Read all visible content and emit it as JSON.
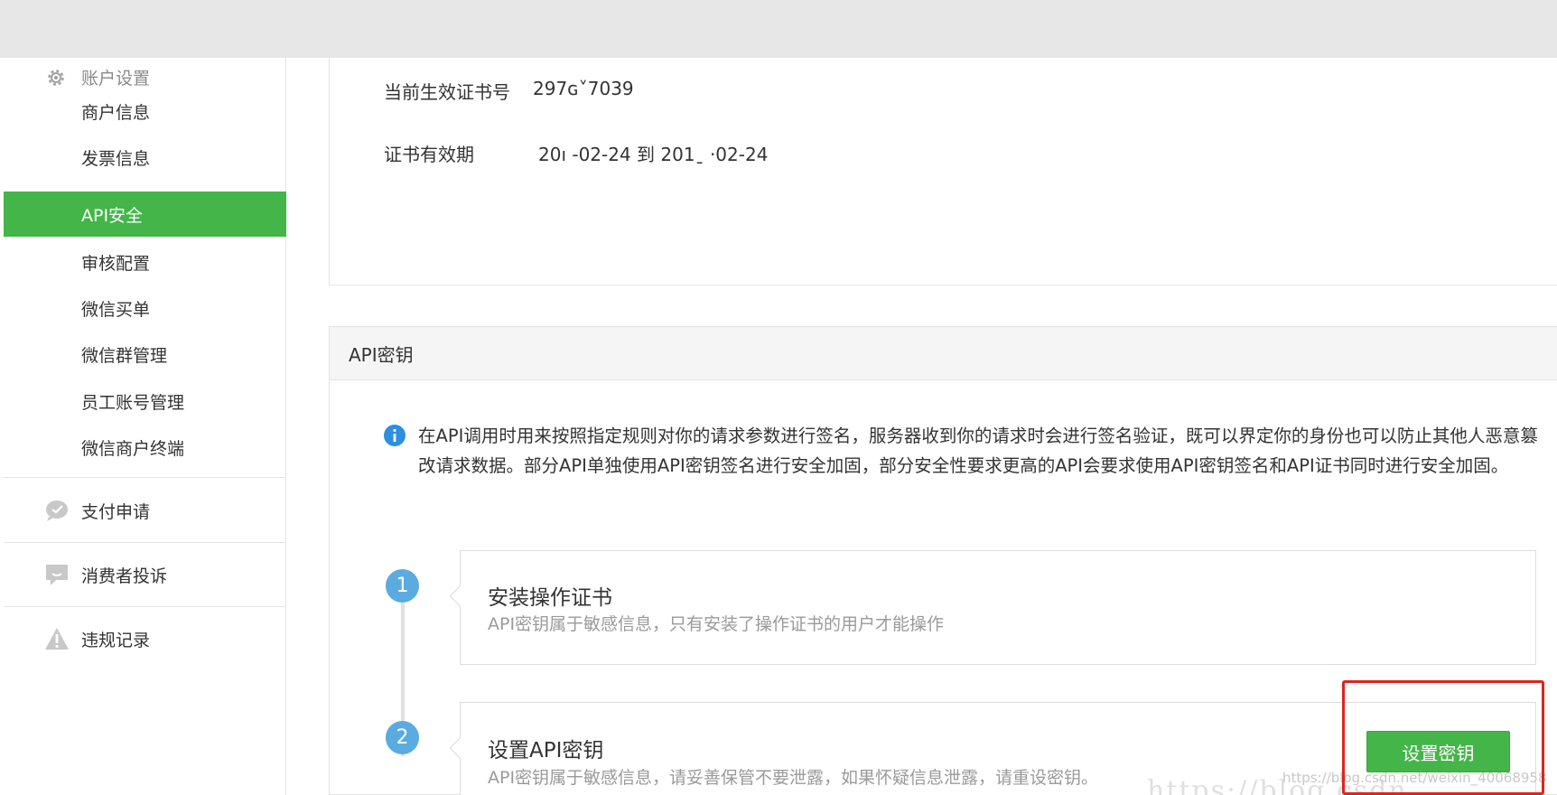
{
  "sidebar": {
    "account_settings": "账户设置",
    "items": [
      {
        "label": "商户信息",
        "active": false
      },
      {
        "label": "发票信息",
        "active": false
      },
      {
        "label": "API安全",
        "active": true
      },
      {
        "label": "审核配置",
        "active": false
      },
      {
        "label": "微信买单",
        "active": false
      },
      {
        "label": "微信群管理",
        "active": false
      },
      {
        "label": "员工账号管理",
        "active": false
      },
      {
        "label": "微信商户终端",
        "active": false
      }
    ],
    "sections": [
      {
        "label": "支付申请",
        "icon": "chat-bubble-icon"
      },
      {
        "label": "消费者投诉",
        "icon": "comment-icon"
      },
      {
        "label": "违规记录",
        "icon": "warning-icon"
      }
    ]
  },
  "certificate": {
    "serial_label": "当前生效证书号",
    "serial_value": "297ɢ˅7039",
    "validity_label": "证书有效期",
    "validity_value": "20ı  -02-24  到  201ˍ ·02-24"
  },
  "api_key": {
    "header": "API密钥",
    "info": "在API调用时用来按照指定规则对你的请求参数进行签名，服务器收到你的请求时会进行签名验证，既可以界定你的身份也可以防止其他人恶意篡改请求数据。部分API单独使用API密钥签名进行安全加固，部分安全性要求更高的API会要求使用API密钥签名和API证书同时进行安全加固。",
    "steps": [
      {
        "num": "1",
        "title": "安装操作证书",
        "desc": "API密钥属于敏感信息，只有安装了操作证书的用户才能操作"
      },
      {
        "num": "2",
        "title": "设置API密钥",
        "desc": "API密钥属于敏感信息，请妥善保管不要泄露，如果怀疑信息泄露，请重设密钥。"
      }
    ],
    "set_key_button": "设置密钥"
  },
  "watermark": {
    "small": "https://blog.csdn.net/weixin_40068958",
    "large": "https://blog.csdn"
  },
  "colors": {
    "accent": "#44b549",
    "step": "#5aabe0",
    "highlight": "#e0241d"
  }
}
